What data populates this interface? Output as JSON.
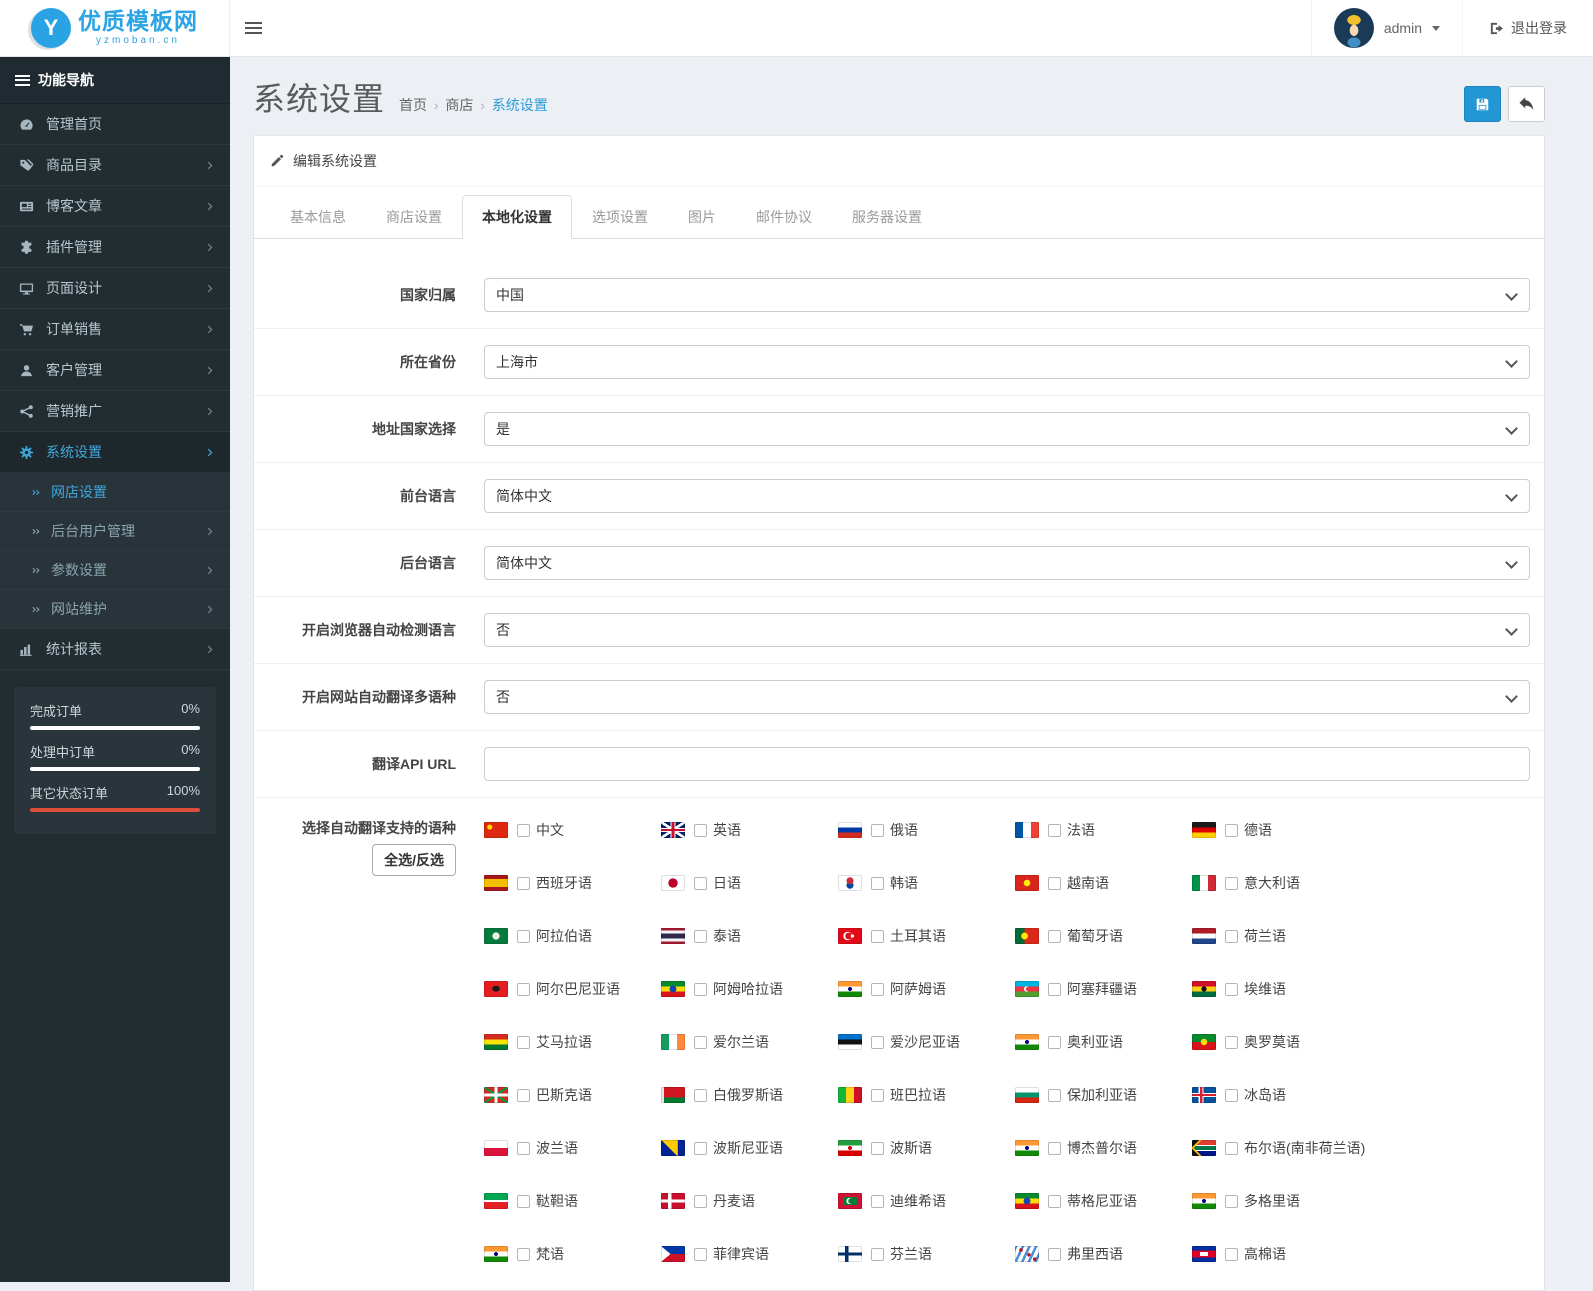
{
  "colors": {
    "accent": "#3fa7dc",
    "save_button": "#2397d4",
    "danger_bar": "#dd4b39",
    "sidebar_bg": "#222d32"
  },
  "brand": {
    "name": "优质模板网",
    "domain": "yzmoban.cn",
    "logo_letter": "Y"
  },
  "topbar": {
    "username": "admin",
    "logout_label": "退出登录"
  },
  "sidebar": {
    "nav_title": "功能导航",
    "menu": [
      {
        "label": "管理首页",
        "icon": "dashboard-icon",
        "has_children": false
      },
      {
        "label": "商品目录",
        "icon": "tags-icon",
        "has_children": true
      },
      {
        "label": "博客文章",
        "icon": "newspaper-icon",
        "has_children": true
      },
      {
        "label": "插件管理",
        "icon": "puzzle-icon",
        "has_children": true
      },
      {
        "label": "页面设计",
        "icon": "desktop-icon",
        "has_children": true
      },
      {
        "label": "订单销售",
        "icon": "cart-icon",
        "has_children": true
      },
      {
        "label": "客户管理",
        "icon": "customer-icon",
        "has_children": true
      },
      {
        "label": "营销推广",
        "icon": "share-icon",
        "has_children": true
      },
      {
        "label": "系统设置",
        "icon": "gear-icon",
        "has_children": true,
        "active": true,
        "children": [
          {
            "label": "网店设置",
            "active": true,
            "has_children": false
          },
          {
            "label": "后台用户管理",
            "has_children": true
          },
          {
            "label": "参数设置",
            "has_children": true
          },
          {
            "label": "网站维护",
            "has_children": true
          }
        ]
      },
      {
        "label": "统计报表",
        "icon": "bar-chart-icon",
        "has_children": true
      }
    ],
    "order_stats": [
      {
        "label": "完成订单",
        "value": "0%",
        "bar_color": "#ffffff"
      },
      {
        "label": "处理中订单",
        "value": "0%",
        "bar_color": "#ffffff"
      },
      {
        "label": "其它状态订单",
        "value": "100%",
        "bar_color": "#dd4b39"
      }
    ]
  },
  "page": {
    "title": "系统设置",
    "breadcrumb": [
      {
        "label": "首页"
      },
      {
        "label": "商店"
      },
      {
        "label": "系统设置",
        "current": true
      }
    ]
  },
  "panel": {
    "heading": "编辑系统设置",
    "tabs": [
      {
        "label": "基本信息"
      },
      {
        "label": "商店设置"
      },
      {
        "label": "本地化设置",
        "active": true
      },
      {
        "label": "选项设置"
      },
      {
        "label": "图片"
      },
      {
        "label": "邮件协议"
      },
      {
        "label": "服务器设置"
      }
    ],
    "fields": [
      {
        "name": "country-select",
        "label": "国家归属",
        "type": "select",
        "value": "中国"
      },
      {
        "name": "province-select",
        "label": "所在省份",
        "type": "select",
        "value": "上海市"
      },
      {
        "name": "address-country-select",
        "label": "地址国家选择",
        "type": "select",
        "value": "是"
      },
      {
        "name": "frontend-language-select",
        "label": "前台语言",
        "type": "select",
        "value": "简体中文"
      },
      {
        "name": "backend-language-select",
        "label": "后台语言",
        "type": "select",
        "value": "简体中文"
      },
      {
        "name": "browser-language-detect-select",
        "label": "开启浏览器自动检测语言",
        "type": "select",
        "value": "否"
      },
      {
        "name": "auto-translate-select",
        "label": "开启网站自动翻译多语种",
        "type": "select",
        "value": "否"
      },
      {
        "name": "translate-api-url-input",
        "label": "翻译API URL",
        "type": "text",
        "value": ""
      }
    ],
    "languages_field": {
      "label": "选择自动翻译支持的语种",
      "select_all_label": "全选/反选",
      "options": [
        {
          "label": "中文",
          "flag": "china",
          "checked": false
        },
        {
          "label": "英语",
          "flag": "uk",
          "checked": false
        },
        {
          "label": "俄语",
          "flag": "russia",
          "checked": false
        },
        {
          "label": "法语",
          "flag": "france",
          "checked": false
        },
        {
          "label": "德语",
          "flag": "germany",
          "checked": false
        },
        {
          "label": "西班牙语",
          "flag": "spain",
          "checked": false
        },
        {
          "label": "日语",
          "flag": "japan",
          "checked": false
        },
        {
          "label": "韩语",
          "flag": "south-korea",
          "checked": false
        },
        {
          "label": "越南语",
          "flag": "vietnam",
          "checked": false
        },
        {
          "label": "意大利语",
          "flag": "italy",
          "checked": false
        },
        {
          "label": "阿拉伯语",
          "flag": "arab-league",
          "checked": false
        },
        {
          "label": "泰语",
          "flag": "thailand",
          "checked": false
        },
        {
          "label": "土耳其语",
          "flag": "turkey",
          "checked": false
        },
        {
          "label": "葡萄牙语",
          "flag": "portugal",
          "checked": false
        },
        {
          "label": "荷兰语",
          "flag": "netherlands",
          "checked": false
        },
        {
          "label": "阿尔巴尼亚语",
          "flag": "albania",
          "checked": false
        },
        {
          "label": "阿姆哈拉语",
          "flag": "ethiopia",
          "checked": false
        },
        {
          "label": "阿萨姆语",
          "flag": "india",
          "checked": false
        },
        {
          "label": "阿塞拜疆语",
          "flag": "azerbaijan",
          "checked": false
        },
        {
          "label": "埃维语",
          "flag": "ghana",
          "checked": false
        },
        {
          "label": "艾马拉语",
          "flag": "bolivia",
          "checked": false
        },
        {
          "label": "爱尔兰语",
          "flag": "ireland",
          "checked": false
        },
        {
          "label": "爱沙尼亚语",
          "flag": "estonia",
          "checked": false
        },
        {
          "label": "奥利亚语",
          "flag": "india",
          "checked": false
        },
        {
          "label": "奥罗莫语",
          "flag": "oromo",
          "checked": false
        },
        {
          "label": "巴斯克语",
          "flag": "basque",
          "checked": false
        },
        {
          "label": "白俄罗斯语",
          "flag": "belarus",
          "checked": false
        },
        {
          "label": "班巴拉语",
          "flag": "mali",
          "checked": false
        },
        {
          "label": "保加利亚语",
          "flag": "bulgaria",
          "checked": false
        },
        {
          "label": "冰岛语",
          "flag": "iceland",
          "checked": false
        },
        {
          "label": "波兰语",
          "flag": "poland",
          "checked": false
        },
        {
          "label": "波斯尼亚语",
          "flag": "bosnia",
          "checked": false
        },
        {
          "label": "波斯语",
          "flag": "iran",
          "checked": false
        },
        {
          "label": "博杰普尔语",
          "flag": "india",
          "checked": false
        },
        {
          "label": "布尔语(南非荷兰语)",
          "flag": "south-africa",
          "checked": false
        },
        {
          "label": "鞑靼语",
          "flag": "tatarstan",
          "checked": false
        },
        {
          "label": "丹麦语",
          "flag": "denmark",
          "checked": false
        },
        {
          "label": "迪维希语",
          "flag": "maldives",
          "checked": false
        },
        {
          "label": "蒂格尼亚语",
          "flag": "ethiopia",
          "checked": false
        },
        {
          "label": "多格里语",
          "flag": "india",
          "checked": false
        },
        {
          "label": "梵语",
          "flag": "india",
          "checked": false
        },
        {
          "label": "菲律宾语",
          "flag": "philippines",
          "checked": false
        },
        {
          "label": "芬兰语",
          "flag": "finland",
          "checked": false
        },
        {
          "label": "弗里西语",
          "flag": "frisia",
          "checked": false
        },
        {
          "label": "高棉语",
          "flag": "cambodia",
          "checked": false
        }
      ]
    }
  }
}
